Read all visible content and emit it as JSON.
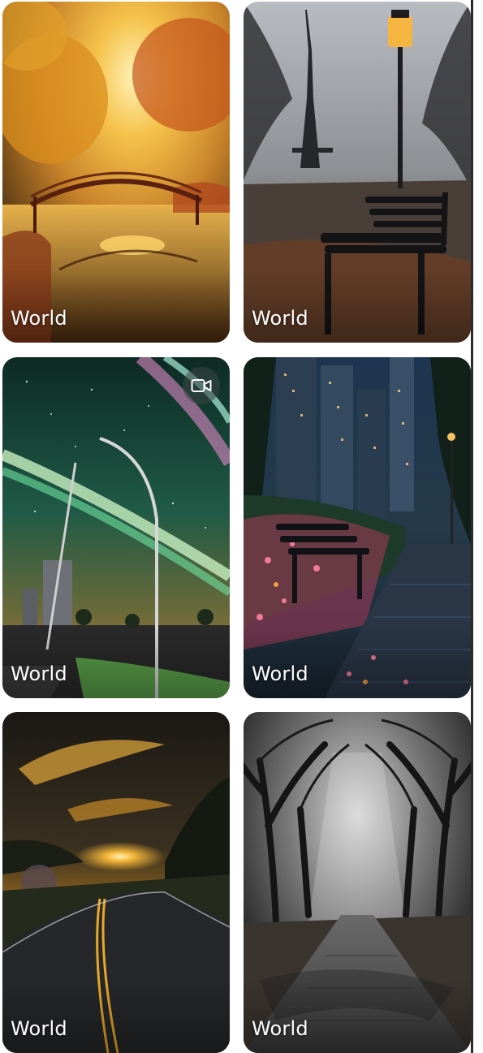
{
  "gallery": {
    "cards": [
      {
        "label": "World",
        "scene": "autumn-bridge"
      },
      {
        "label": "World",
        "scene": "paris-bench"
      },
      {
        "label": "World",
        "scene": "aurora-street",
        "video": true,
        "video_icon": "video-camera-icon"
      },
      {
        "label": "World",
        "scene": "city-flowers"
      },
      {
        "label": "World",
        "scene": "sunset-road"
      },
      {
        "label": "World",
        "scene": "tree-path"
      }
    ]
  },
  "colors": {
    "label_text": "#ffffff",
    "scrollbar": "#2b2b2b"
  }
}
